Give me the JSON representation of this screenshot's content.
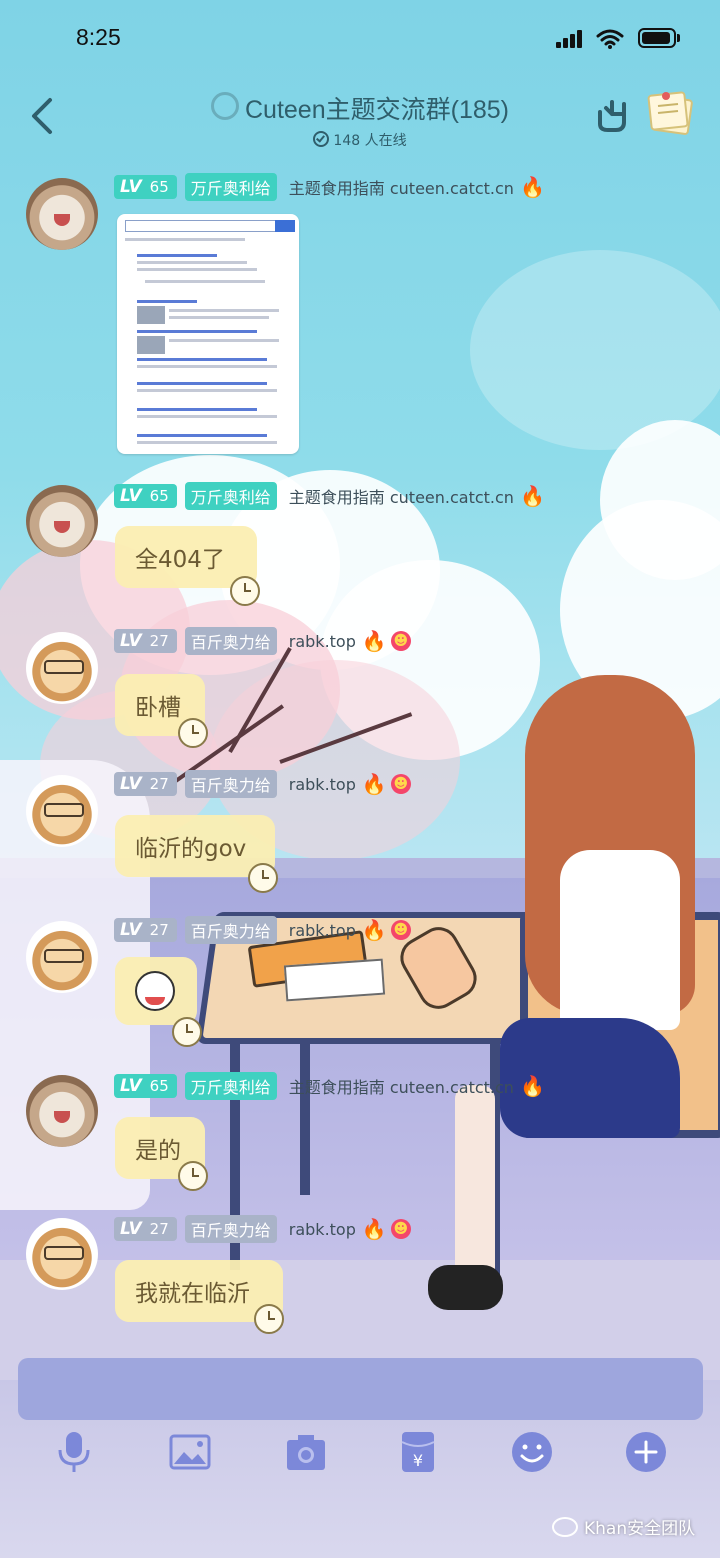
{
  "status_bar": {
    "time": "8:25"
  },
  "header": {
    "group_title": "Cuteen主题交流群(185)",
    "online_count": "148 人在线"
  },
  "messages": [
    {
      "level": "LV",
      "level_num": "65",
      "title": "万斤奥利给",
      "tag": "主题食用指南 cuteen.catct.cn",
      "type": "image",
      "content": ""
    },
    {
      "level": "LV",
      "level_num": "65",
      "title": "万斤奥利给",
      "tag": "主题食用指南 cuteen.catct.cn",
      "type": "text",
      "content": "全404了"
    },
    {
      "level": "LV",
      "level_num": "27",
      "title": "百斤奥力给",
      "tag": "rabk.top",
      "type": "text",
      "content": "卧槽"
    },
    {
      "level": "LV",
      "level_num": "27",
      "title": "百斤奥力给",
      "tag": "rabk.top",
      "type": "text",
      "content": "临沂的gov"
    },
    {
      "level": "LV",
      "level_num": "27",
      "title": "百斤奥力给",
      "tag": "rabk.top",
      "type": "sticker",
      "content": ""
    },
    {
      "level": "LV",
      "level_num": "65",
      "title": "万斤奥利给",
      "tag": "主题食用指南 cuteen.catct.cn",
      "type": "text",
      "content": "是的"
    },
    {
      "level": "LV",
      "level_num": "27",
      "title": "百斤奥力给",
      "tag": "rabk.top",
      "type": "text",
      "content": "我就在临沂"
    }
  ],
  "toolbar": {
    "icons": [
      "microphone-icon",
      "image-icon",
      "camera-icon",
      "red-packet-icon",
      "emoji-icon",
      "plus-icon"
    ]
  },
  "watermark": "Khan安全团队",
  "colors": {
    "lv65": "#3fd1c1",
    "lv27": "#a9b3c8",
    "bubble": "#fbeeb2",
    "input": "#9ea6dd"
  }
}
